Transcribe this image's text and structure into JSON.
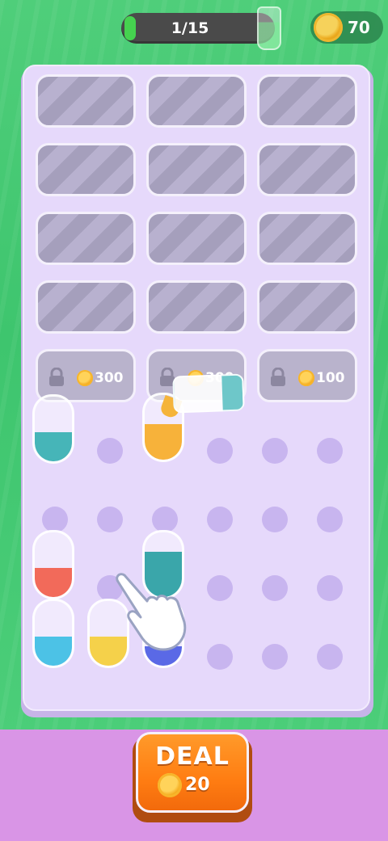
{
  "header": {
    "level_progress_text": "1/15",
    "level_progress_fraction": 0.067,
    "coins": "70"
  },
  "slots": {
    "locked_rows": 4,
    "unlock_costs": [
      "300",
      "300",
      "100"
    ]
  },
  "colors": {
    "teal": "#46b5b8",
    "orange": "#f7b23a",
    "coral": "#f26a5a",
    "cyan": "#4cc2e6",
    "yellow": "#f5d14a",
    "blue": "#5a69e6",
    "deal_button": "#ff7d12"
  },
  "tubes": [
    {
      "name": "tube-teal-top",
      "color": "teal",
      "fill": 0.45
    },
    {
      "name": "tube-orange-top",
      "color": "orange",
      "fill": 0.55
    },
    {
      "name": "tube-coral",
      "color": "coral",
      "fill": 0.45
    },
    {
      "name": "tube-teal-dark",
      "color": "teal",
      "fill": 0.7
    },
    {
      "name": "tube-cyan",
      "color": "cyan",
      "fill": 0.45
    },
    {
      "name": "tube-yellow",
      "color": "yellow",
      "fill": 0.45
    },
    {
      "name": "tube-blue",
      "color": "blue",
      "fill": 0.3
    }
  ],
  "deal_button": {
    "label": "DEAL",
    "cost": "20"
  },
  "icons": [
    "coin-icon",
    "lock-icon",
    "pointing-hand-icon",
    "progress-cup-icon"
  ]
}
